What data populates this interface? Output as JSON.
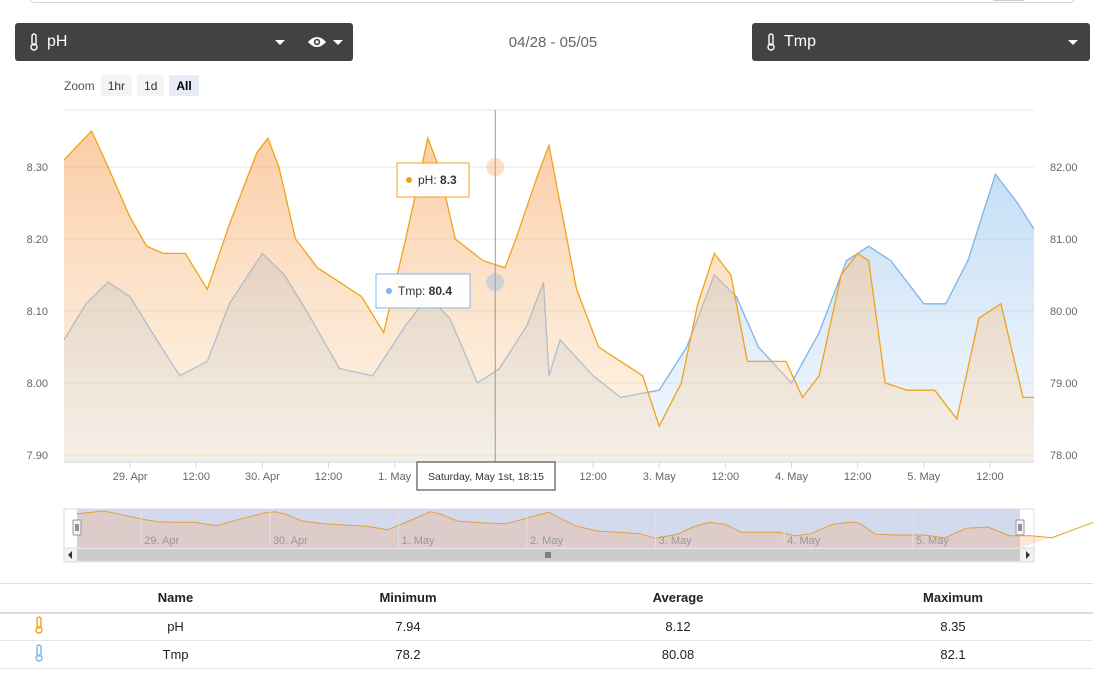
{
  "controls": {
    "left_select": {
      "value": "pH",
      "icon": "thermometer-icon"
    },
    "view_toggle": {
      "icon": "eye-icon"
    },
    "date_range": "04/28 - 05/05",
    "right_select": {
      "value": "Tmp",
      "icon": "thermometer-icon"
    },
    "zoom": {
      "label": "Zoom",
      "buttons": [
        "1hr",
        "1d",
        "All"
      ],
      "active": "All"
    }
  },
  "tooltips": {
    "ph": {
      "label": "pH: ",
      "value": "8.3"
    },
    "tmp": {
      "label": "Tmp: ",
      "value": "80.4"
    },
    "date": "Saturday, May 1st, 18:15"
  },
  "colors": {
    "ph": "#f0a31a",
    "tmp": "#7cb5ec",
    "dropdown_bg": "#424242"
  },
  "chart_data": {
    "type": "area",
    "x_range": [
      "2021-04-28T12:00",
      "2021-05-05T20:00"
    ],
    "x_tick_labels": [
      "29. Apr",
      "12:00",
      "30. Apr",
      "12:00",
      "1. May",
      "12:00",
      "12:00",
      "3. May",
      "12:00",
      "4. May",
      "12:00",
      "5. May",
      "12:00"
    ],
    "navigator_labels": [
      "29. Apr",
      "30. Apr",
      "1. May",
      "2. May",
      "3. May",
      "4. May",
      "5. May"
    ],
    "y_left": {
      "ylim": [
        7.9,
        8.35
      ],
      "ticks": [
        "7.90",
        "8.00",
        "8.10",
        "8.20",
        "8.30"
      ]
    },
    "y_right": {
      "ylim": [
        78.0,
        82.5
      ],
      "ticks": [
        "78.00",
        "79.00",
        "80.00",
        "81.00",
        "82.00"
      ]
    },
    "grid": true,
    "crosshair_x": "2021-05-01T18:15",
    "series": [
      {
        "name": "pH",
        "axis": "left",
        "points": [
          [
            "04-28 12:00",
            8.31
          ],
          [
            "04-28 17:00",
            8.35
          ],
          [
            "04-28 20:00",
            8.3
          ],
          [
            "04-29 00:00",
            8.23
          ],
          [
            "04-29 03:00",
            8.19
          ],
          [
            "04-29 06:00",
            8.18
          ],
          [
            "04-29 10:00",
            8.18
          ],
          [
            "04-29 14:00",
            8.13
          ],
          [
            "04-29 18:00",
            8.22
          ],
          [
            "04-29 23:00",
            8.32
          ],
          [
            "04-30 01:00",
            8.34
          ],
          [
            "04-30 03:00",
            8.3
          ],
          [
            "04-30 06:00",
            8.2
          ],
          [
            "04-30 10:00",
            8.16
          ],
          [
            "04-30 14:00",
            8.14
          ],
          [
            "04-30 18:00",
            8.12
          ],
          [
            "04-30 22:00",
            8.07
          ],
          [
            "05-01 02:00",
            8.2
          ],
          [
            "05-01 06:00",
            8.34
          ],
          [
            "05-01 08:00",
            8.3
          ],
          [
            "05-01 11:00",
            8.2
          ],
          [
            "05-01 16:00",
            8.17
          ],
          [
            "05-01 20:00",
            8.16
          ],
          [
            "05-01 22:00",
            8.2
          ],
          [
            "05-02 02:00",
            8.29
          ],
          [
            "05-02 04:00",
            8.33
          ],
          [
            "05-02 06:00",
            8.25
          ],
          [
            "05-02 09:00",
            8.13
          ],
          [
            "05-02 13:00",
            8.05
          ],
          [
            "05-02 17:00",
            8.03
          ],
          [
            "05-02 21:00",
            8.01
          ],
          [
            "05-03 00:00",
            7.94
          ],
          [
            "05-03 04:00",
            8.0
          ],
          [
            "05-03 07:00",
            8.11
          ],
          [
            "05-03 10:00",
            8.18
          ],
          [
            "05-03 13:00",
            8.15
          ],
          [
            "05-03 16:00",
            8.03
          ],
          [
            "05-03 20:00",
            8.03
          ],
          [
            "05-03 23:00",
            8.03
          ],
          [
            "05-04 02:00",
            7.98
          ],
          [
            "05-04 05:00",
            8.01
          ],
          [
            "05-04 09:00",
            8.15
          ],
          [
            "05-04 12:00",
            8.18
          ],
          [
            "05-04 14:00",
            8.17
          ],
          [
            "05-04 17:00",
            8.0
          ],
          [
            "05-04 21:00",
            7.99
          ],
          [
            "05-05 02:00",
            7.99
          ],
          [
            "05-05 06:00",
            7.95
          ],
          [
            "05-05 10:00",
            8.09
          ],
          [
            "05-05 14:00",
            8.11
          ],
          [
            "05-05 18:00",
            7.98
          ],
          [
            "05-05 22:00",
            7.98
          ],
          [
            "05-06 02:00",
            7.95
          ],
          [
            "05-06 07:00",
            8.1
          ],
          [
            "05-06 10:00",
            8.19
          ]
        ]
      },
      {
        "name": "Tmp",
        "axis": "right",
        "points": [
          [
            "04-28 12:00",
            79.6
          ],
          [
            "04-28 16:00",
            80.1
          ],
          [
            "04-28 20:00",
            80.4
          ],
          [
            "04-29 00:00",
            80.2
          ],
          [
            "04-29 04:00",
            79.7
          ],
          [
            "04-29 09:00",
            79.1
          ],
          [
            "04-29 14:00",
            79.3
          ],
          [
            "04-29 18:00",
            80.1
          ],
          [
            "04-30 00:00",
            80.8
          ],
          [
            "04-30 04:00",
            80.5
          ],
          [
            "04-30 08:00",
            80.0
          ],
          [
            "04-30 14:00",
            79.2
          ],
          [
            "04-30 20:00",
            79.1
          ],
          [
            "05-01 02:00",
            79.8
          ],
          [
            "05-01 06:00",
            80.2
          ],
          [
            "05-01 10:00",
            79.9
          ],
          [
            "05-01 15:00",
            79.0
          ],
          [
            "05-01 19:00",
            79.2
          ],
          [
            "05-02 00:00",
            79.8
          ],
          [
            "05-02 03:00",
            80.4
          ],
          [
            "05-02 04:00",
            79.1
          ],
          [
            "05-02 06:00",
            79.6
          ],
          [
            "05-02 12:00",
            79.1
          ],
          [
            "05-02 17:00",
            78.8
          ],
          [
            "05-03 00:00",
            78.9
          ],
          [
            "05-03 05:00",
            79.5
          ],
          [
            "05-03 10:00",
            80.5
          ],
          [
            "05-03 14:00",
            80.2
          ],
          [
            "05-03 18:00",
            79.5
          ],
          [
            "05-04 00:00",
            79.0
          ],
          [
            "05-04 05:00",
            79.7
          ],
          [
            "05-04 10:00",
            80.7
          ],
          [
            "05-04 14:00",
            80.9
          ],
          [
            "05-04 18:00",
            80.7
          ],
          [
            "05-05 00:00",
            80.1
          ],
          [
            "05-05 04:00",
            80.1
          ],
          [
            "05-05 08:00",
            80.7
          ],
          [
            "05-05 13:00",
            81.9
          ],
          [
            "05-05 17:00",
            81.5
          ],
          [
            "05-05 22:00",
            80.9
          ],
          [
            "05-06 02:00",
            80.3
          ],
          [
            "05-06 06:00",
            80.3
          ],
          [
            "05-06 10:00",
            81.5
          ]
        ]
      }
    ]
  },
  "stats": {
    "headers": [
      "Name",
      "Minimum",
      "Average",
      "Maximum"
    ],
    "rows": [
      {
        "icon": "thermometer-icon",
        "name": "pH",
        "min": "7.94",
        "avg": "8.12",
        "max": "8.35"
      },
      {
        "icon": "thermometer-icon",
        "name": "Tmp",
        "min": "78.2",
        "avg": "80.08",
        "max": "82.1"
      }
    ]
  }
}
